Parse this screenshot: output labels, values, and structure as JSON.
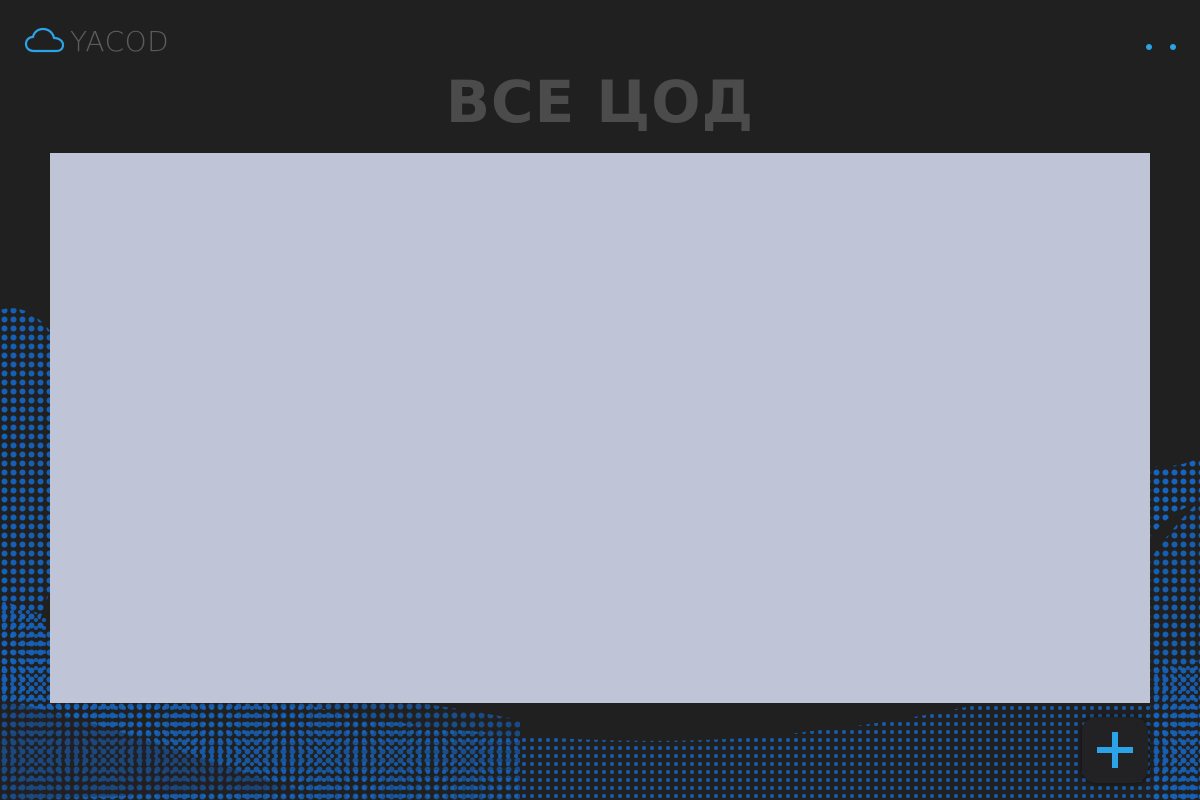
{
  "header": {
    "logo_text": "YACOD",
    "logo_icon": "cloud-icon",
    "menu_icon": "more-dots-icon"
  },
  "main": {
    "title": "ВСЕ ЦОД"
  },
  "fab": {
    "icon": "plus-icon"
  },
  "colors": {
    "background": "#212021",
    "accent": "#2aa4e6",
    "wave": "#1565c0",
    "panel": "#c0c4d7",
    "title_text": "#4b4b4b",
    "logo_text": "#5c5c5c"
  }
}
